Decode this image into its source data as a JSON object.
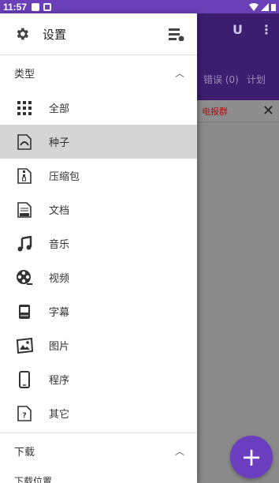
{
  "status_bar": {
    "time": "11:57"
  },
  "background_app": {
    "tabs": [
      "错误 (0)",
      "计划"
    ],
    "banner_text": "电报群",
    "toolbar_icons": [
      "U",
      "⋮"
    ],
    "fab_label": "+"
  },
  "drawer": {
    "header": {
      "settings_label": "设置"
    },
    "types_section": {
      "title": "类型"
    },
    "items": [
      {
        "label": "全部",
        "icon": "grid-icon"
      },
      {
        "label": "种子",
        "icon": "torrent-file-icon",
        "selected": true
      },
      {
        "label": "压缩包",
        "icon": "archive-file-icon"
      },
      {
        "label": "文档",
        "icon": "document-file-icon"
      },
      {
        "label": "音乐",
        "icon": "music-note-icon"
      },
      {
        "label": "视频",
        "icon": "film-reel-icon"
      },
      {
        "label": "字幕",
        "icon": "subtitle-file-icon"
      },
      {
        "label": "图片",
        "icon": "image-icon"
      },
      {
        "label": "程序",
        "icon": "phone-icon"
      },
      {
        "label": "其它",
        "icon": "question-file-icon"
      }
    ],
    "download_section": {
      "title": "下载"
    },
    "download_location_label": "下载位置"
  }
}
